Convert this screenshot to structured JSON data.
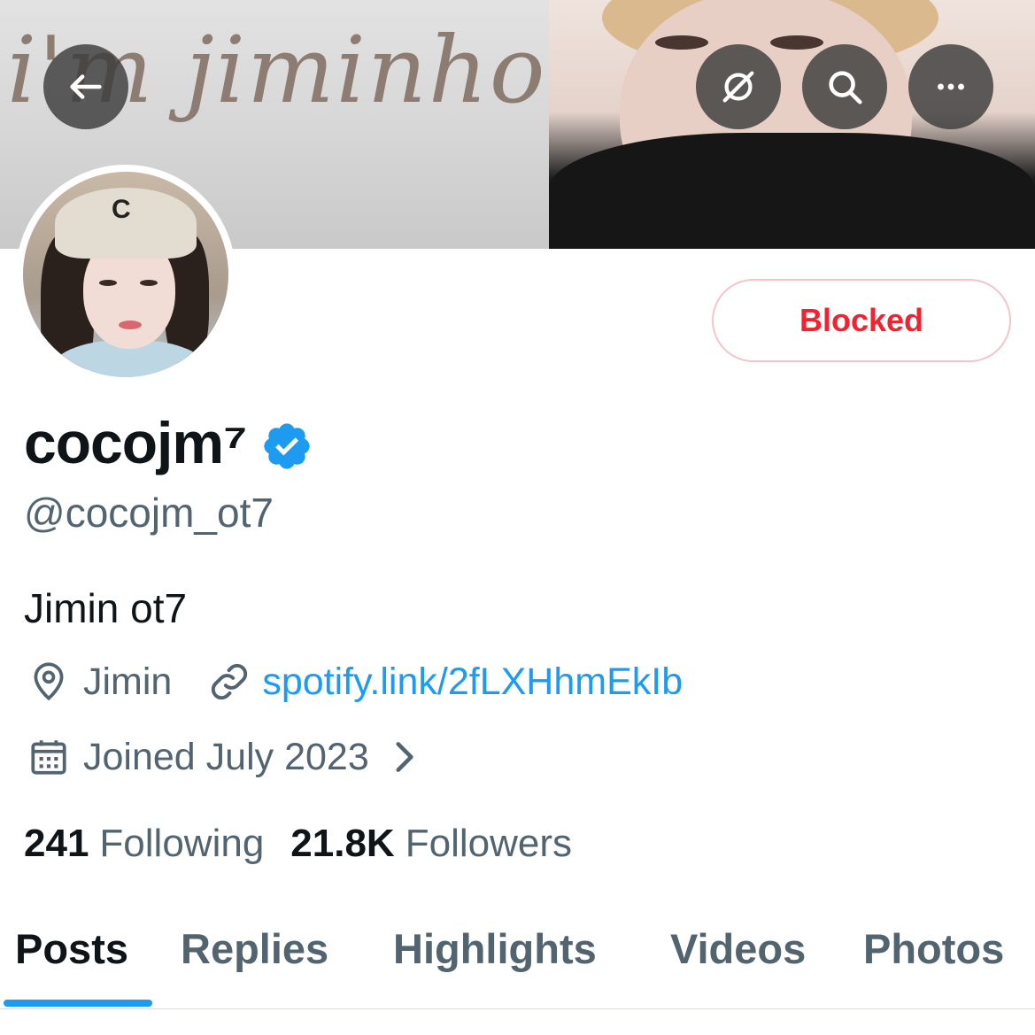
{
  "banner": {
    "text": "i'm jiminholic"
  },
  "header": {
    "icons": [
      "back-arrow-icon",
      "translate-off-icon",
      "search-icon",
      "more-icon"
    ]
  },
  "profile": {
    "action_button": "Blocked",
    "display_name": "cocojm⁷",
    "handle": "@cocojm_ot7",
    "bio": "Jimin ot7",
    "location": "Jimin",
    "link": "spotify.link/2fLXHhmEkIb",
    "joined": "Joined July 2023",
    "following_count": "241",
    "following_label": "Following",
    "followers_count": "21.8K",
    "followers_label": "Followers"
  },
  "tabs": [
    {
      "label": "Posts",
      "active": true
    },
    {
      "label": "Replies",
      "active": false
    },
    {
      "label": "Highlights",
      "active": false
    },
    {
      "label": "Videos",
      "active": false
    },
    {
      "label": "Photos",
      "active": false
    }
  ],
  "colors": {
    "accent": "#1d9bf0",
    "blocked_red": "#f4212e",
    "secondary_text": "#536471"
  }
}
